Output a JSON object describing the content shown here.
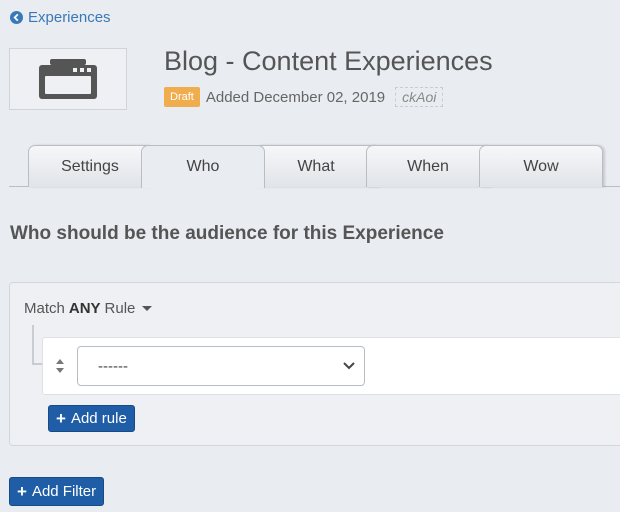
{
  "nav": {
    "back_label": "Experiences",
    "back_icon": "arrow-circle-left-icon"
  },
  "header": {
    "thumbnail_icon": "browser-window-icon",
    "title": "Blog - Content Experiences",
    "status_badge": "Draft",
    "added_text": "Added December 02, 2019",
    "code": "ckAoi"
  },
  "tabs": [
    {
      "label": "Settings",
      "active": false
    },
    {
      "label": "Who",
      "active": true
    },
    {
      "label": "What",
      "active": false
    },
    {
      "label": "When",
      "active": false
    },
    {
      "label": "Wow",
      "active": false
    }
  ],
  "audience": {
    "heading": "Who should be the audience for this Experience",
    "match_prefix": "Match",
    "match_mode": "ANY",
    "match_suffix": "Rule",
    "rule_select_value": "------",
    "add_rule_label": "Add rule",
    "add_filter_label": "Add Filter"
  },
  "colors": {
    "background": "#e9ecf1",
    "link": "#3a79b8",
    "badge": "#f0ad4e",
    "primary_button": "#1f5da6"
  }
}
